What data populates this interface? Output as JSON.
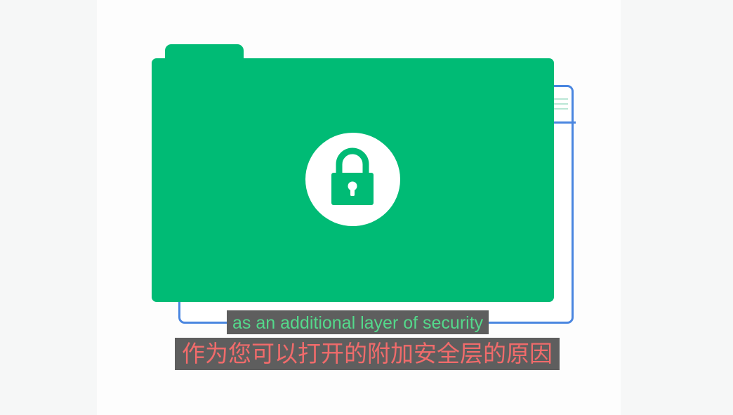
{
  "illustration": {
    "icon": "lock-icon",
    "colors": {
      "folder": "#00bb75",
      "window_outline": "#4a86e0",
      "lock": "#00bb75"
    }
  },
  "subtitles": {
    "english": "as an additional layer of security",
    "chinese": "作为您可以打开的附加安全层的原因"
  }
}
